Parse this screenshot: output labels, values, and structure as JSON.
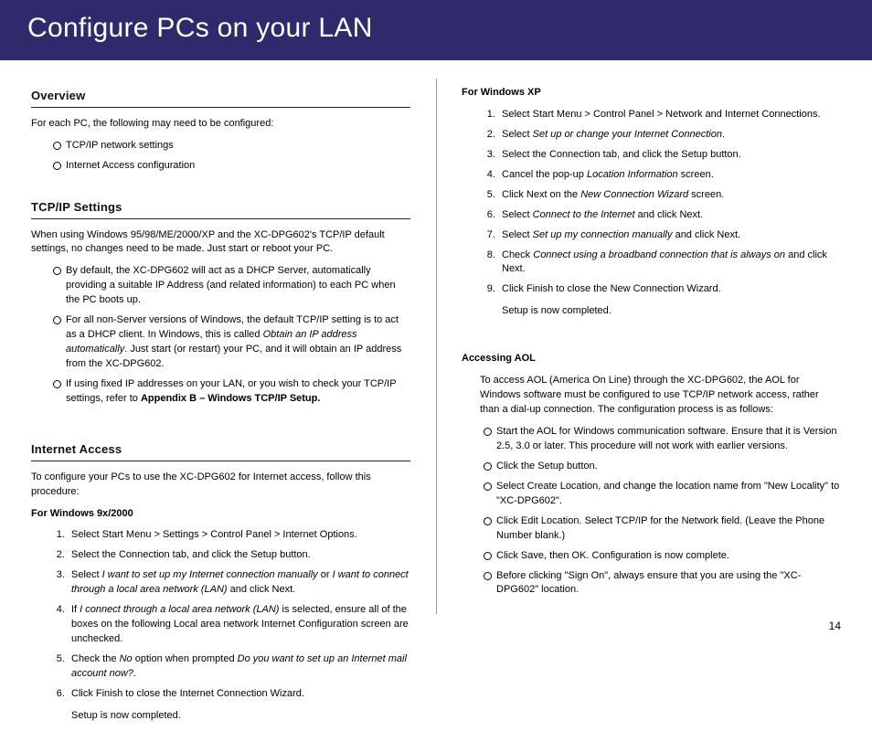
{
  "banner_title": "Configure PCs on your LAN",
  "page_number": "14",
  "left": {
    "overview": {
      "heading": "Overview",
      "intro": "For each PC, the following may need to be configured:",
      "bullets": [
        "TCP/IP network settings",
        "Internet Access configuration"
      ]
    },
    "tcpip": {
      "heading": "TCP/IP Settings",
      "intro": "When using Windows 95/98/ME/2000/XP and the XC-DPG602's TCP/IP default settings, no changes need to be made. Just start or reboot your PC.",
      "bullets": [
        {
          "plain": "By default, the XC-DPG602 will act as a DHCP Server, automatically providing a suitable IP Address (and related information) to each PC when the PC boots up."
        },
        {
          "pre": "For all non-Server versions of Windows, the default TCP/IP setting is to act as a DHCP client. In Windows, this is called ",
          "italic": "Obtain an IP address automatically",
          "post": ". Just start (or restart) your PC, and it will obtain an IP address from the XC-DPG602."
        },
        {
          "pre": "If using fixed IP addresses on your LAN, or you wish to check your TCP/IP settings, refer to ",
          "bold": "Appendix B – Windows TCP/IP Setup.",
          "post": ""
        }
      ]
    },
    "internet": {
      "heading": "Internet Access",
      "intro": "To configure your PCs to use the XC-DPG602 for Internet access, follow this procedure:",
      "win9x": {
        "subhead": "For Windows 9x/2000",
        "steps": [
          {
            "plain": "Select Start Menu > Settings > Control Panel > Internet Options."
          },
          {
            "plain": "Select the Connection tab, and click the Setup button."
          },
          {
            "pre": "Select ",
            "italic": "I want to set up my Internet connection manually",
            "mid": " or ",
            "italic2": "I want to connect through a local area network (LAN)",
            "post": " and click Next."
          },
          {
            "pre": "If ",
            "italic": "I connect through a local area network (LAN)",
            "post": " is selected, ensure all of the boxes on the following Local area network Internet Configuration screen are unchecked."
          },
          {
            "pre": "Check the ",
            "italic": "No",
            "mid": " option when prompted ",
            "italic2": "Do you want to set up an Internet mail account now?",
            "post": "."
          },
          {
            "plain": "Click Finish to close the Internet Connection Wizard."
          }
        ],
        "closing": "Setup is now completed."
      }
    }
  },
  "right": {
    "winxp": {
      "subhead": "For Windows XP",
      "steps": [
        {
          "plain": "Select Start Menu > Control Panel > Network and Internet Connections."
        },
        {
          "pre": "Select ",
          "italic": "Set up or change your Internet Connection",
          "post": "."
        },
        {
          "plain": "Select the Connection tab, and click the Setup button."
        },
        {
          "pre": "Cancel the pop-up ",
          "italic": "Location Information",
          "post": " screen."
        },
        {
          "pre": "Click Next on the ",
          "italic": "New Connection Wizard",
          "post": " screen."
        },
        {
          "pre": "Select ",
          "italic": "Connect to the Internet",
          "post": " and click Next."
        },
        {
          "pre": "Select ",
          "italic": "Set up my connection manually",
          "post": " and click Next."
        },
        {
          "pre": "Check ",
          "italic": "Connect using a broadband connection that is always on",
          "post": " and click Next."
        },
        {
          "plain": "Click Finish to close the New Connection Wizard."
        }
      ],
      "closing": "Setup is now completed."
    },
    "aol": {
      "subhead": "Accessing AOL",
      "intro": "To access AOL (America On Line) through the XC-DPG602, the AOL for Windows software must be configured to use TCP/IP network access, rather than a dial-up connection. The configuration process is as follows:",
      "bullets": [
        "Start the AOL for Windows communication software. Ensure that it is Version 2.5, 3.0 or later. This procedure will not work with earlier versions.",
        "Click the Setup button.",
        "Select Create Location, and change the location name from \"New Locality\" to \"XC-DPG602\".",
        "Click Edit Location. Select TCP/IP for the Network field. (Leave the Phone Number blank.)",
        "Click Save, then OK. Configuration is now complete.",
        "Before clicking \"Sign On\", always ensure that you are using the \"XC-DPG602\" location."
      ]
    }
  }
}
